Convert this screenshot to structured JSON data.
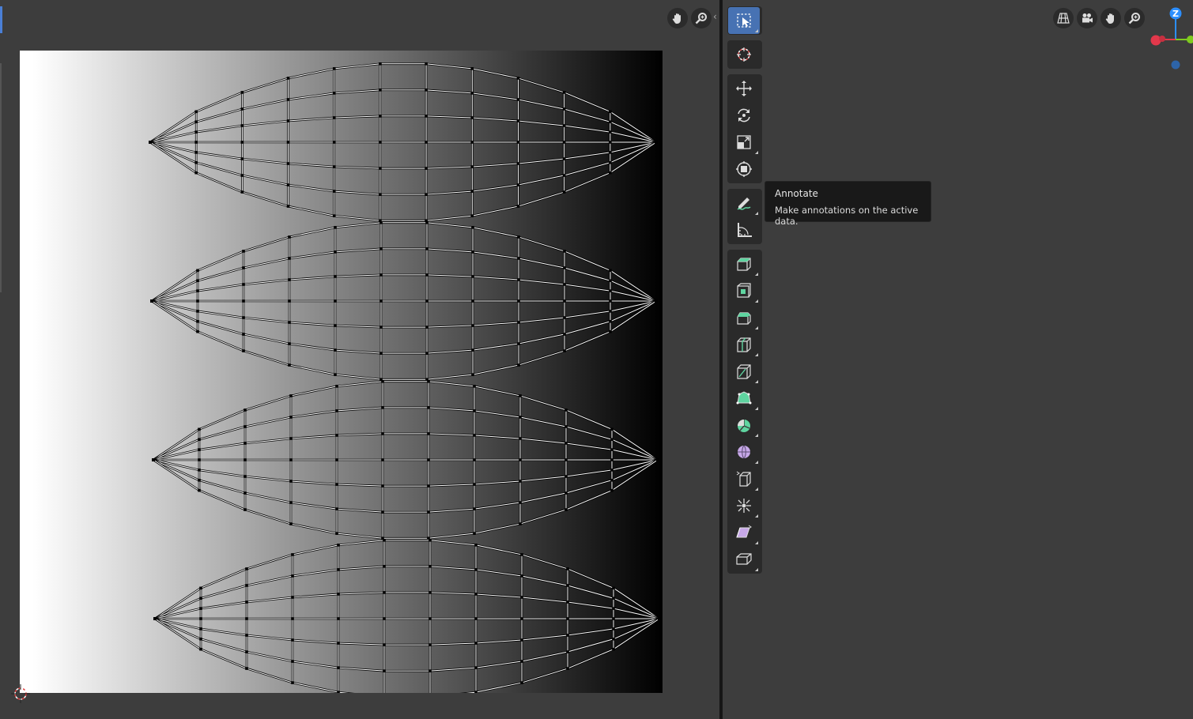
{
  "uv_editor": {
    "header_tools": [
      {
        "icon": "hand-pan-icon"
      },
      {
        "icon": "zoom-magnifier-icon"
      }
    ],
    "image_gradient": {
      "from": "#ffffff",
      "to": "#000000"
    }
  },
  "viewport": {
    "header_tools": [
      {
        "icon": "perspective-grid-icon"
      },
      {
        "icon": "camera-view-icon"
      },
      {
        "icon": "hand-pan-icon"
      },
      {
        "icon": "zoom-magnifier-icon"
      }
    ],
    "toolbar": [
      {
        "group": [
          "select-box-icon"
        ]
      },
      {
        "group": [
          "cursor-icon"
        ]
      },
      {
        "group": [
          "move-icon",
          "rotate-icon",
          "scale-icon",
          "transform-icon"
        ]
      },
      {
        "group": [
          "annotate-icon",
          "measure-icon"
        ]
      },
      {
        "group": [
          "extrude-region-icon",
          "inset-faces-icon",
          "bevel-icon",
          "loop-cut-icon",
          "knife-icon",
          "poly-build-icon",
          "spin-icon",
          "smooth-icon",
          "edge-slide-icon",
          "shrink-fatten-icon",
          "shear-icon",
          "rip-region-icon"
        ]
      }
    ],
    "tooltip": {
      "title": "Annotate",
      "description": "Make annotations on the active data."
    },
    "gizmo": {
      "z_label": "Z",
      "x_color": "#e2384b",
      "y_color": "#7fcb1f",
      "z_color": "#2c8fff"
    },
    "mesh_color": "#8d8f92"
  },
  "colors": {
    "background": "#3d3d3d",
    "active_tool": "#4772b3",
    "uv_edge": "#ffffff",
    "uv_vertex": "#000000"
  }
}
